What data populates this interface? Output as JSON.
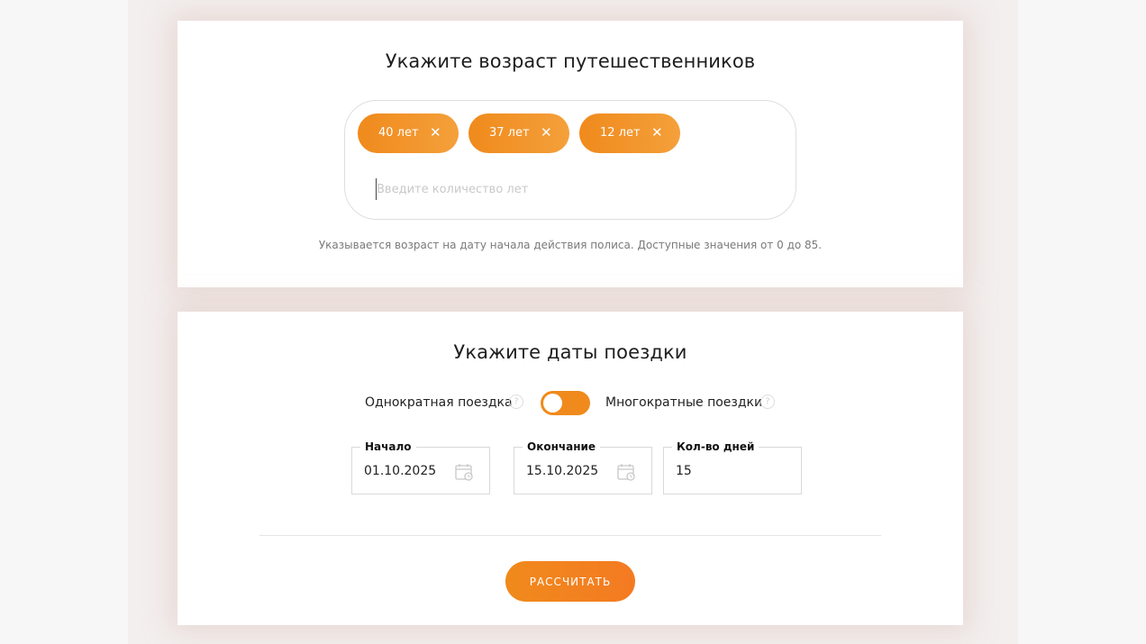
{
  "ages_section": {
    "title": "Укажите возраст путешественников",
    "chips": [
      {
        "label": "40 лет",
        "close": "✕"
      },
      {
        "label": "37 лет",
        "close": "✕"
      },
      {
        "label": "12 лет",
        "close": "✕"
      }
    ],
    "input_placeholder": "Введите количество лет",
    "hint": "Указывается возраст на дату начала действия полиса. Доступные значения от 0 до 85."
  },
  "dates_section": {
    "title": "Укажите даты поездки",
    "single_trip_label": "Однократная поездка",
    "multi_trip_label": "Многократные поездки",
    "help_glyph": "?",
    "toggle_state": "single",
    "start": {
      "label": "Начало",
      "value": "01.10.2025"
    },
    "end": {
      "label": "Окончание",
      "value": "15.10.2025"
    },
    "days": {
      "label": "Кол-во дней",
      "value": "15"
    },
    "calculate_button": "РАССЧИТАТЬ"
  },
  "colors": {
    "accent": "#f08a1c",
    "accent_light": "#f4a03b"
  }
}
